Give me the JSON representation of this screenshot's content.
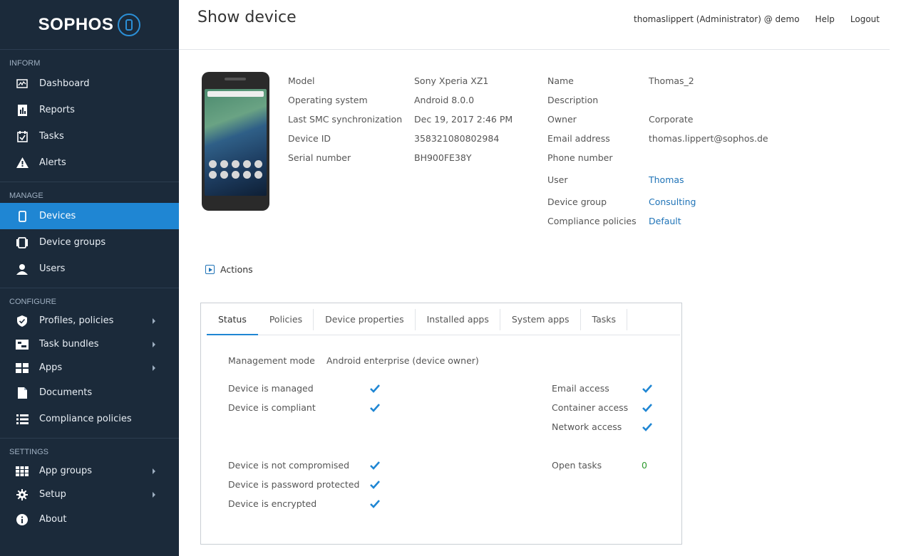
{
  "brand": {
    "name": "SOPHOS"
  },
  "header": {
    "title": "Show device",
    "user": "thomaslippert (Administrator) @ demo",
    "help": "Help",
    "logout": "Logout"
  },
  "sidebar": {
    "inform": {
      "title": "INFORM",
      "items": [
        {
          "label": "Dashboard",
          "icon": "dashboard-icon"
        },
        {
          "label": "Reports",
          "icon": "reports-icon"
        },
        {
          "label": "Tasks",
          "icon": "tasks-icon"
        },
        {
          "label": "Alerts",
          "icon": "alert-icon"
        }
      ]
    },
    "manage": {
      "title": "MANAGE",
      "items": [
        {
          "label": "Devices",
          "icon": "device-icon",
          "active": true
        },
        {
          "label": "Device groups",
          "icon": "device-groups-icon"
        },
        {
          "label": "Users",
          "icon": "user-icon"
        }
      ]
    },
    "configure": {
      "title": "CONFIGURE",
      "items": [
        {
          "label": "Profiles, policies",
          "icon": "shield-icon"
        },
        {
          "label": "Task bundles",
          "icon": "task-bundles-icon"
        },
        {
          "label": "Apps",
          "icon": "apps-icon"
        },
        {
          "label": "Documents",
          "icon": "document-icon"
        },
        {
          "label": "Compliance policies",
          "icon": "list-icon"
        }
      ]
    },
    "settings": {
      "title": "SETTINGS",
      "items": [
        {
          "label": "App groups",
          "icon": "app-groups-icon"
        },
        {
          "label": "Setup",
          "icon": "gear-icon"
        },
        {
          "label": "About",
          "icon": "info-icon"
        }
      ]
    }
  },
  "device": {
    "left": [
      {
        "label": "Model",
        "value": "Sony Xperia XZ1"
      },
      {
        "label": "Operating system",
        "value": "Android 8.0.0"
      },
      {
        "label": "Last SMC synchronization",
        "value": "Dec 19, 2017 2:46 PM"
      },
      {
        "label": "Device ID",
        "value": "358321080802984"
      },
      {
        "label": "Serial number",
        "value": "BH900FE38Y"
      }
    ],
    "right": [
      {
        "label": "Name",
        "value": "Thomas_2"
      },
      {
        "label": "Description",
        "value": ""
      },
      {
        "label": "Owner",
        "value": "Corporate"
      },
      {
        "label": "Email address",
        "value": "thomas.lippert@sophos.de"
      },
      {
        "label": "Phone number",
        "value": ""
      },
      {
        "label": "User",
        "value": "Thomas"
      },
      {
        "label": "Device group",
        "value": "Consulting"
      },
      {
        "label": "Compliance policies",
        "value": "Default"
      }
    ]
  },
  "actions": {
    "label": "Actions"
  },
  "tabs": [
    "Status",
    "Policies",
    "Device properties",
    "Installed apps",
    "System apps",
    "Tasks"
  ],
  "status": {
    "management_mode_label": "Management mode",
    "management_mode_value": "Android enterprise (device owner)",
    "left": [
      {
        "label": "Device is managed"
      },
      {
        "label": "Device is compliant"
      },
      {
        "label": "Device is not compromised"
      },
      {
        "label": "Device is password protected"
      },
      {
        "label": "Device is encrypted"
      }
    ],
    "right": [
      {
        "label": "Email access"
      },
      {
        "label": "Container access"
      },
      {
        "label": "Network access"
      }
    ],
    "open_tasks_label": "Open tasks",
    "open_tasks_value": "0"
  },
  "colors": {
    "sidebar_bg": "#1b2a3a",
    "accent": "#1f86d3",
    "link": "#1f73b7",
    "check": "#1f86d3"
  }
}
